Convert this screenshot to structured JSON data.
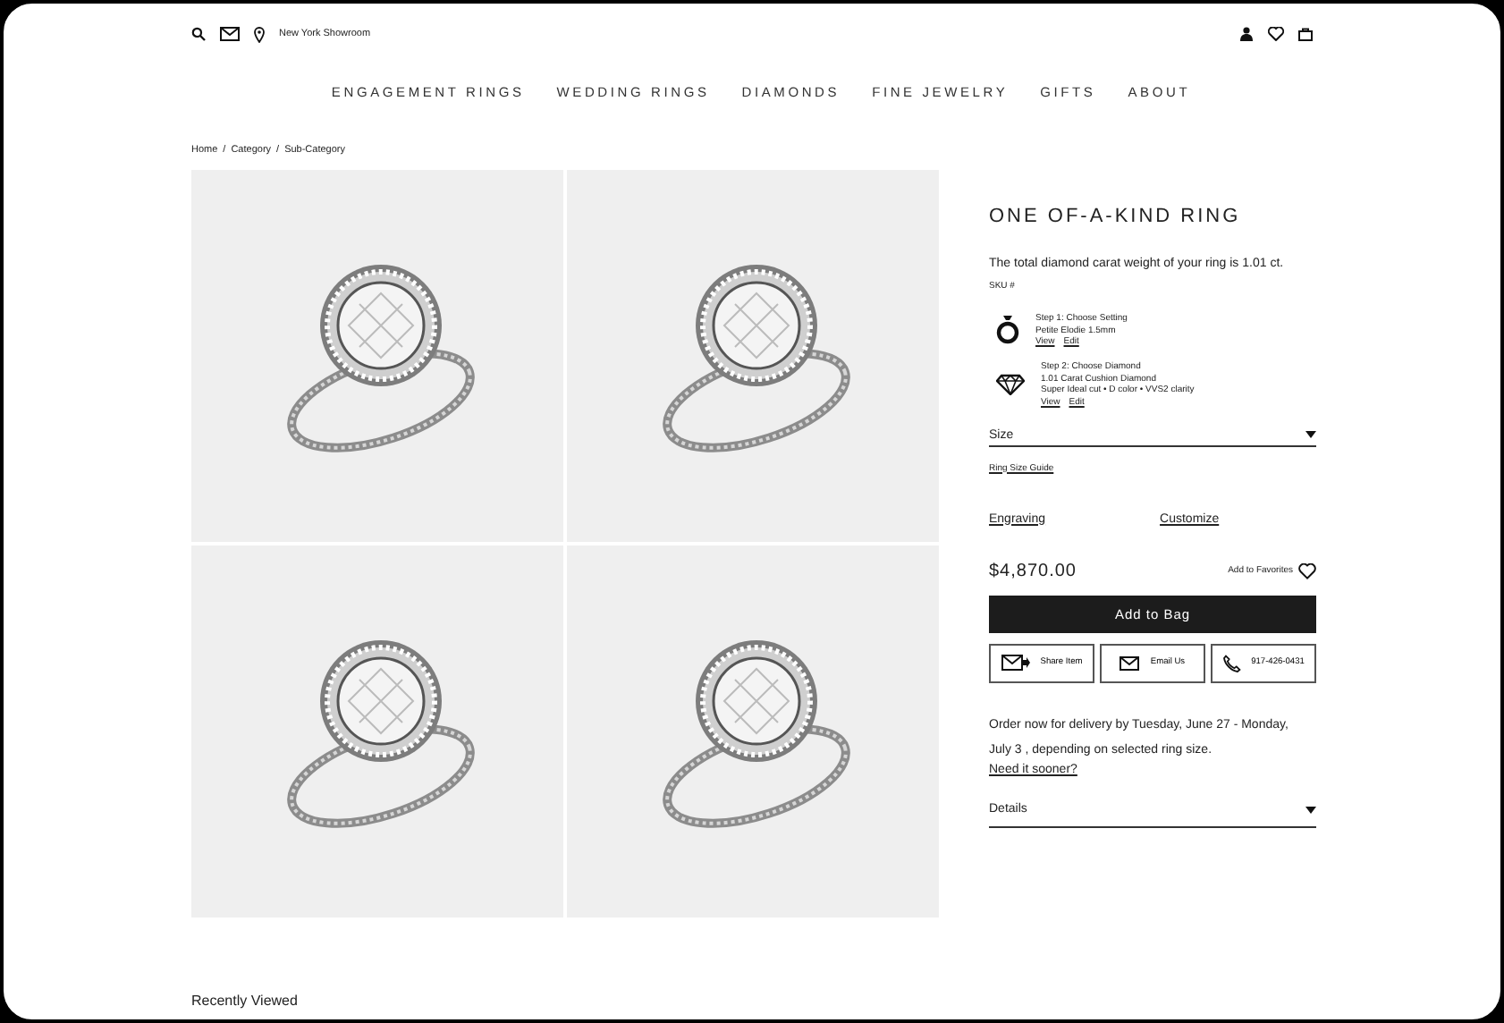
{
  "header": {
    "location": "New York Showroom"
  },
  "nav": [
    "ENGAGEMENT RINGS",
    "WEDDING RINGS",
    "DIAMONDS",
    "FINE JEWELRY",
    "GIFTS",
    "ABOUT"
  ],
  "breadcrumb": [
    "Home",
    "Category",
    "Sub-Category"
  ],
  "breadcrumb_separator": "/",
  "photos": [
    {
      "kind": "ring"
    },
    {
      "kind": "ring"
    },
    {
      "kind": "ring"
    },
    {
      "kind": "ring"
    }
  ],
  "product": {
    "title": "ONE OF-A-KIND RING",
    "carat_text": "The total diamond carat weight of your ring is 1.01 ct.",
    "sku": "SKU #",
    "steps": [
      {
        "kind": "setting",
        "lines": [
          "Step 1: Choose Setting",
          "Petite Elodie 1.5mm"
        ],
        "links": [
          "View",
          "Edit"
        ]
      },
      {
        "kind": "diamond",
        "lines": [
          "Step 2: Choose Diamond",
          "1.01 Carat Cushion Diamond",
          "Super Ideal cut • D color • VVS2 clarity"
        ],
        "links": [
          "View",
          "Edit"
        ]
      }
    ],
    "size_label": "Size",
    "size_guide": "Ring Size Guide",
    "options": [
      "Engraving",
      "Customize"
    ],
    "price": "$4,870.00",
    "favorites": "Add to Favorites",
    "add_button": "Add to Bag",
    "contact_buttons": [
      {
        "kind": "share",
        "label": "Share Item"
      },
      {
        "kind": "email",
        "label": "Email Us"
      },
      {
        "kind": "phone",
        "label": "917-426-0431"
      }
    ],
    "delivery": "Order now for delivery by Tuesday, June 27 - Monday, July 3 , depending on selected ring size.",
    "sooner_link": "Need it sooner?",
    "details": "Details"
  },
  "recently_viewed": "Recently Viewed"
}
